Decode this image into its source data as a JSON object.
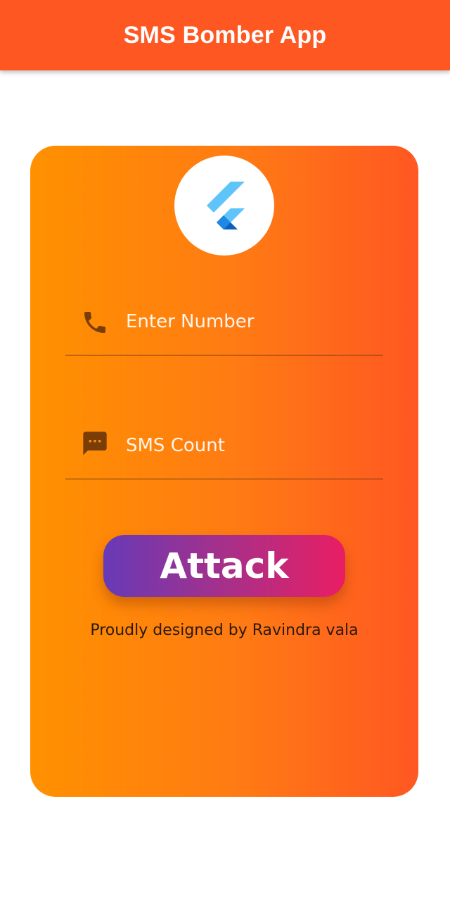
{
  "app_bar": {
    "title": "SMS Bomber App",
    "color": "#ff5722"
  },
  "card": {
    "gradient_start": "#ff9100",
    "gradient_end": "#ff5722",
    "logo": {
      "icon": "flutter-logo-icon"
    },
    "phone_field": {
      "icon": "phone-icon",
      "placeholder": "Enter Number",
      "value": ""
    },
    "sms_field": {
      "icon": "sms-icon",
      "placeholder": "SMS Count",
      "value": ""
    },
    "attack_button": {
      "label": "Attack",
      "gradient_start": "#673ab7",
      "gradient_end": "#e91e63"
    },
    "footer": "Proudly designed by Ravindra vala"
  }
}
